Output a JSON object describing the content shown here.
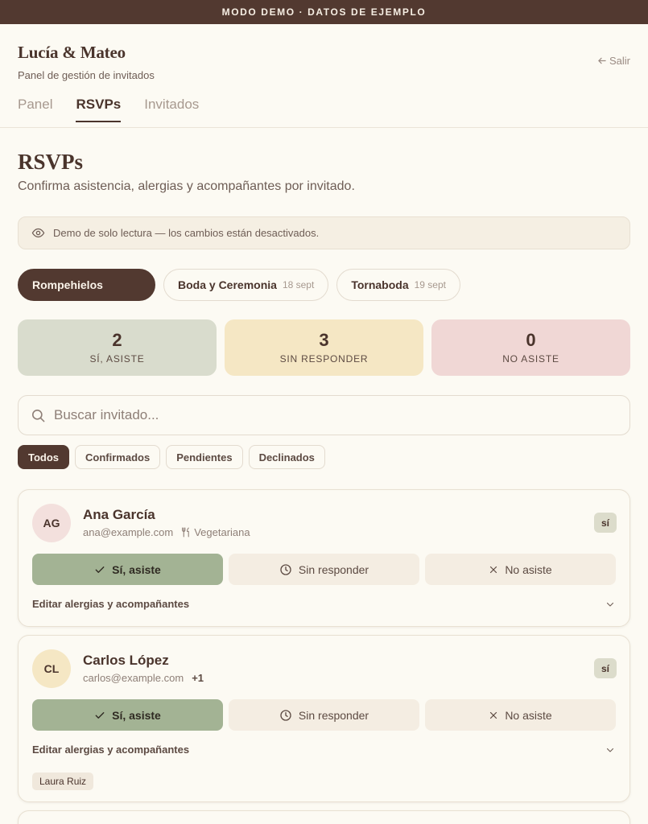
{
  "banner": {
    "text": "MODO DEMO · DATOS DE EJEMPLO"
  },
  "header": {
    "title": "Lucía & Mateo",
    "subtitle": "Panel de gestión de invitados",
    "logout_label": "Salir",
    "tabs": [
      {
        "label": "Panel",
        "active": false
      },
      {
        "label": "RSVPs",
        "active": true
      },
      {
        "label": "Invitados",
        "active": false
      }
    ]
  },
  "page": {
    "title": "RSVPs",
    "subtitle": "Confirma asistencia, alergias y acompañantes por invitado."
  },
  "notice": {
    "text": "Demo de solo lectura — los cambios están desactivados."
  },
  "events": [
    {
      "label": "Rompehielos",
      "date": "",
      "active": true
    },
    {
      "label": "Boda y Ceremonia",
      "date": "18 sept",
      "active": false
    },
    {
      "label": "Tornaboda",
      "date": "19 sept",
      "active": false
    }
  ],
  "stats": [
    {
      "value": "2",
      "label": "SÍ, ASISTE",
      "color": "#d9dccd"
    },
    {
      "value": "3",
      "label": "SIN RESPONDER",
      "color": "#f5e7c4"
    },
    {
      "value": "0",
      "label": "NO ASISTE",
      "color": "#f0d7d5"
    }
  ],
  "search": {
    "placeholder": "Buscar invitado...",
    "value": ""
  },
  "filters": [
    {
      "label": "Todos",
      "active": true
    },
    {
      "label": "Confirmados",
      "active": false
    },
    {
      "label": "Pendientes",
      "active": false
    },
    {
      "label": "Declinados",
      "active": false
    }
  ],
  "rsvp_options": {
    "yes": "Sí, asiste",
    "pending": "Sin responder",
    "no": "No asiste"
  },
  "edit_label": "Editar alergias y acompañantes",
  "guests": [
    {
      "initials": "AG",
      "avatar_color": "#f3e0dd",
      "name": "Ana García",
      "email": "ana@example.com",
      "diet": "Vegetariana",
      "plus": "",
      "status": "sí",
      "companions": []
    },
    {
      "initials": "CL",
      "avatar_color": "#f5e7c4",
      "name": "Carlos López",
      "email": "carlos@example.com",
      "diet": "",
      "plus": "+1",
      "status": "sí",
      "companions": [
        "Laura Ruiz"
      ]
    }
  ]
}
